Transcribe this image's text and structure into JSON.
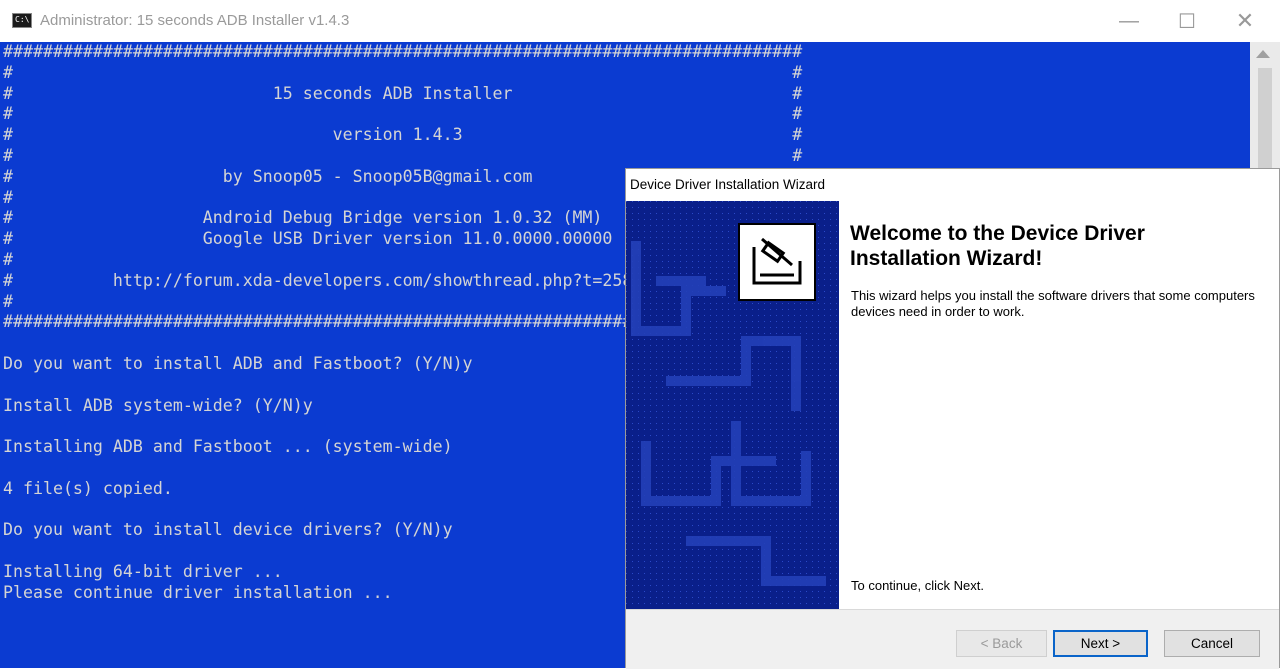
{
  "console": {
    "title": "Administrator:  15 seconds ADB Installer v1.4.3",
    "lines": [
      "################################################################################",
      "#                                                                              #",
      "#                          15 seconds ADB Installer                            #",
      "#                                                                              #",
      "#                                version 1.4.3                                 #",
      "#                                                                              #",
      "#                     by Snoop05 - Snoop05B@gmail.com                          #",
      "#                                                                              #",
      "#                   Android Debug Bridge version 1.0.32 (MM)                   #",
      "#                   Google USB Driver version 11.0.0000.00000                  #",
      "#                                                                              #",
      "#          http://forum.xda-developers.com/showthread.php?t=2588979            #",
      "#                                                                              #",
      "################################################################################",
      "",
      "Do you want to install ADB and Fastboot? (Y/N)y",
      "",
      "Install ADB system-wide? (Y/N)y",
      "",
      "Installing ADB and Fastboot ... (system-wide)",
      "",
      "4 file(s) copied.",
      "",
      "Do you want to install device drivers? (Y/N)y",
      "",
      "Installing 64-bit driver ...",
      "Please continue driver installation ..."
    ],
    "buttons": {
      "minimize": "—",
      "maximize": "☐",
      "close": "✕"
    }
  },
  "wizard": {
    "title": "Device Driver Installation Wizard",
    "heading": "Welcome to the Device Driver Installation Wizard!",
    "description": "This wizard helps you install the software drivers that some computers devices need in order to work.",
    "continue_note": "To continue, click Next.",
    "buttons": {
      "back": "< Back",
      "next": "Next >",
      "cancel": "Cancel"
    }
  },
  "colors": {
    "console_bg": "#0b3bd1",
    "console_text": "#d4d4d4",
    "wizard_side": "#0a1f8a"
  }
}
